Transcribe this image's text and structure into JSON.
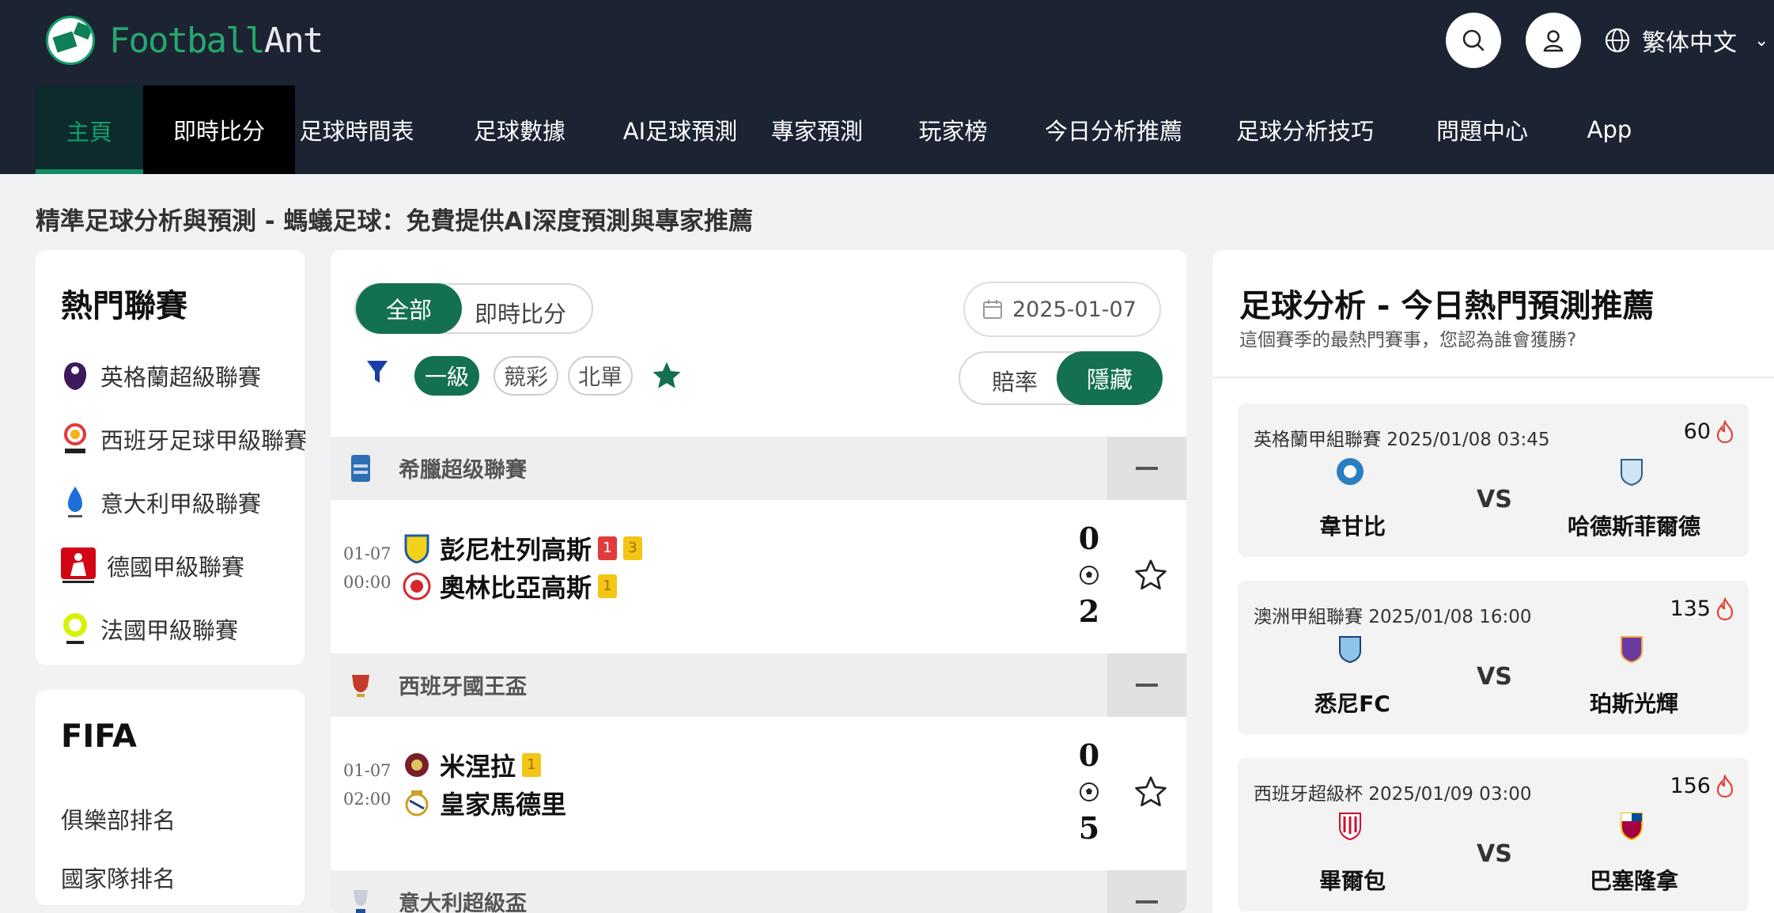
{
  "app": {
    "logo_football": "Football",
    "logo_ant": "Ant",
    "language": "繁体中文"
  },
  "nav": {
    "items": [
      "主頁",
      "即時比分",
      "足球時間表",
      "足球數據",
      "AI足球預測",
      "專家預測",
      "玩家榜",
      "今日分析推薦",
      "足球分析技巧",
      "問題中心",
      "App"
    ]
  },
  "tagline": "精準足球分析與預測 - 螞蟻足球：免費提供AI深度預測與專家推薦",
  "sidebar": {
    "hot_title": "熱門聯賽",
    "leagues": [
      {
        "name": "英格蘭超級聯賽",
        "icon": "premier-league-icon"
      },
      {
        "name": "西班牙足球甲級聯賽",
        "icon": "laliga-icon"
      },
      {
        "name": "意大利甲級聯賽",
        "icon": "serie-a-icon"
      },
      {
        "name": "德國甲級聯賽",
        "icon": "bundesliga-icon"
      },
      {
        "name": "法國甲級聯賽",
        "icon": "ligue1-icon"
      }
    ],
    "fifa_title": "FIFA",
    "fifa_links": [
      "俱樂部排名",
      "國家隊排名"
    ]
  },
  "matches_panel": {
    "toggle_all": "全部",
    "toggle_live": "即時比分",
    "date": "2025-01-07",
    "chips": [
      "一級",
      "競彩",
      "北單"
    ],
    "odds_label": "賠率",
    "hide_label": "隱藏",
    "groups": [
      {
        "league": "希臘超级聯賽",
        "matches": [
          {
            "date": "01-07",
            "time": "00:00",
            "home": "彭尼杜列高斯",
            "away": "奧林比亞高斯",
            "home_red": "1",
            "home_yellow": "3",
            "away_yellow": "1",
            "home_score": "0",
            "away_score": "2"
          }
        ]
      },
      {
        "league": "西班牙國王盃",
        "matches": [
          {
            "date": "01-07",
            "time": "02:00",
            "home": "米涅拉",
            "away": "皇家馬德里",
            "home_yellow": "1",
            "home_score": "0",
            "away_score": "5"
          }
        ]
      },
      {
        "league": "意大利超級盃"
      }
    ]
  },
  "predictions": {
    "title": "足球分析 - 今日熱門預測推薦",
    "subtitle": "這個賽季的最熱門賽事，您認為誰會獲勝?",
    "vs": "VS",
    "cards": [
      {
        "league_time": "英格蘭甲組聯賽 2025/01/08 03:45",
        "heat": "60",
        "home": "韋甘比",
        "away": "哈德斯菲爾德"
      },
      {
        "league_time": "澳洲甲組聯賽 2025/01/08 16:00",
        "heat": "135",
        "home": "悉尼FC",
        "away": "珀斯光輝"
      },
      {
        "league_time": "西班牙超級杯 2025/01/09 03:00",
        "heat": "156",
        "home": "畢爾包",
        "away": "巴塞隆拿"
      }
    ]
  },
  "colors": {
    "header_bg": "#1c2333",
    "brand_green": "#14714f",
    "accent_green": "#13a06a",
    "heat_red": "#e0463a"
  }
}
